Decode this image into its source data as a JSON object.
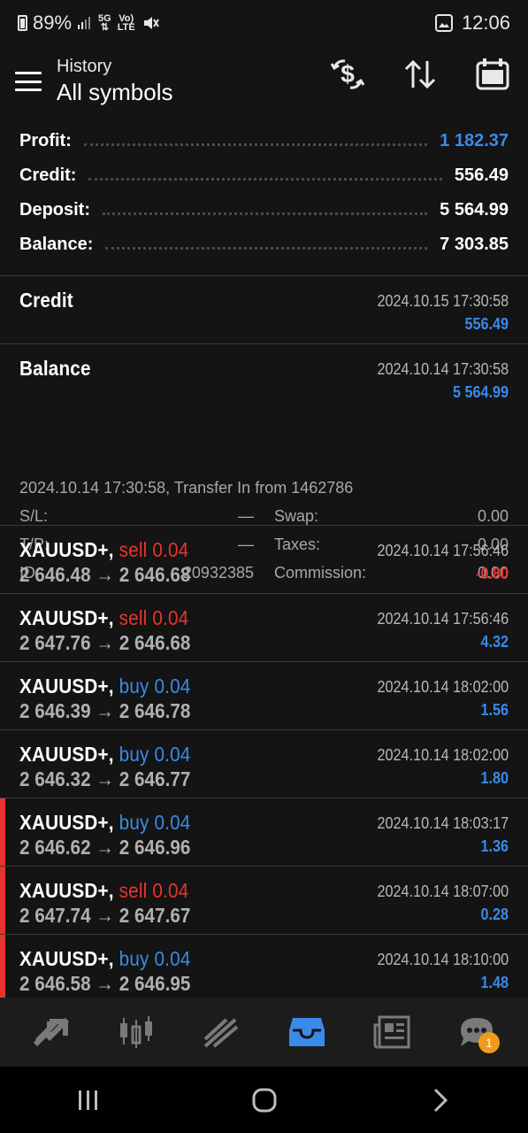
{
  "status": {
    "battery": "89%",
    "network": "5G",
    "volte": "Vo) LTE",
    "time": "12:06"
  },
  "header": {
    "subtitle": "History",
    "title": "All symbols"
  },
  "summary": [
    {
      "label": "Profit:",
      "value": "1 182.37",
      "accent": "blue"
    },
    {
      "label": "Credit:",
      "value": "556.49",
      "accent": "white"
    },
    {
      "label": "Deposit:",
      "value": "5 564.99",
      "accent": "white"
    },
    {
      "label": "Balance:",
      "value": "7 303.85",
      "accent": "white"
    }
  ],
  "entries": {
    "credit": {
      "name": "Credit",
      "date": "2024.10.15 17:30:58",
      "amount": "556.49"
    },
    "balance": {
      "name": "Balance",
      "date": "2024.10.14 17:30:58",
      "amount": "5 564.99",
      "comment": "2024.10.14 17:30:58, Transfer In from 1462786",
      "sl_label": "S/L:",
      "sl_value": "—",
      "tp_label": "T/P:",
      "tp_value": "—",
      "id_label": "ID:",
      "id_value": "20932385",
      "swap_label": "Swap:",
      "swap_value": "0.00",
      "taxes_label": "Taxes:",
      "taxes_value": "0.00",
      "commission_label": "Commission:",
      "commission_value": "0.00"
    },
    "trades": [
      {
        "symbol": "XAUUSD+,",
        "side": "sell 0.04",
        "type": "sell",
        "prices": "2 646.48 → 2 646.68",
        "date": "2024.10.14 17:56:46",
        "profit": "-0.80",
        "negative": true,
        "marked": false
      },
      {
        "symbol": "XAUUSD+,",
        "side": "sell 0.04",
        "type": "sell",
        "prices": "2 647.76 → 2 646.68",
        "date": "2024.10.14 17:56:46",
        "profit": "4.32",
        "negative": false,
        "marked": false
      },
      {
        "symbol": "XAUUSD+,",
        "side": "buy 0.04",
        "type": "buy",
        "prices": "2 646.39 → 2 646.78",
        "date": "2024.10.14 18:02:00",
        "profit": "1.56",
        "negative": false,
        "marked": false
      },
      {
        "symbol": "XAUUSD+,",
        "side": "buy 0.04",
        "type": "buy",
        "prices": "2 646.32 → 2 646.77",
        "date": "2024.10.14 18:02:00",
        "profit": "1.80",
        "negative": false,
        "marked": false
      },
      {
        "symbol": "XAUUSD+,",
        "side": "buy 0.04",
        "type": "buy",
        "prices": "2 646.62 → 2 646.96",
        "date": "2024.10.14 18:03:17",
        "profit": "1.36",
        "negative": false,
        "marked": true
      },
      {
        "symbol": "XAUUSD+,",
        "side": "sell 0.04",
        "type": "sell",
        "prices": "2 647.74 → 2 647.67",
        "date": "2024.10.14 18:07:00",
        "profit": "0.28",
        "negative": false,
        "marked": true
      },
      {
        "symbol": "XAUUSD+,",
        "side": "buy 0.04",
        "type": "buy",
        "prices": "2 646.58 → 2 646.95",
        "date": "2024.10.14 18:10:00",
        "profit": "1.48",
        "negative": false,
        "marked": true
      }
    ]
  },
  "bottom_nav": {
    "items": [
      "quotes-icon",
      "chart-icon",
      "trade-icon",
      "history-icon",
      "news-icon",
      "chat-icon"
    ],
    "active": "history-icon",
    "chat_badge": "1"
  },
  "colors": {
    "background": "#141414",
    "accent_blue": "#3a8ae8",
    "accent_red": "#e8342f",
    "badge": "#f29a1a"
  }
}
